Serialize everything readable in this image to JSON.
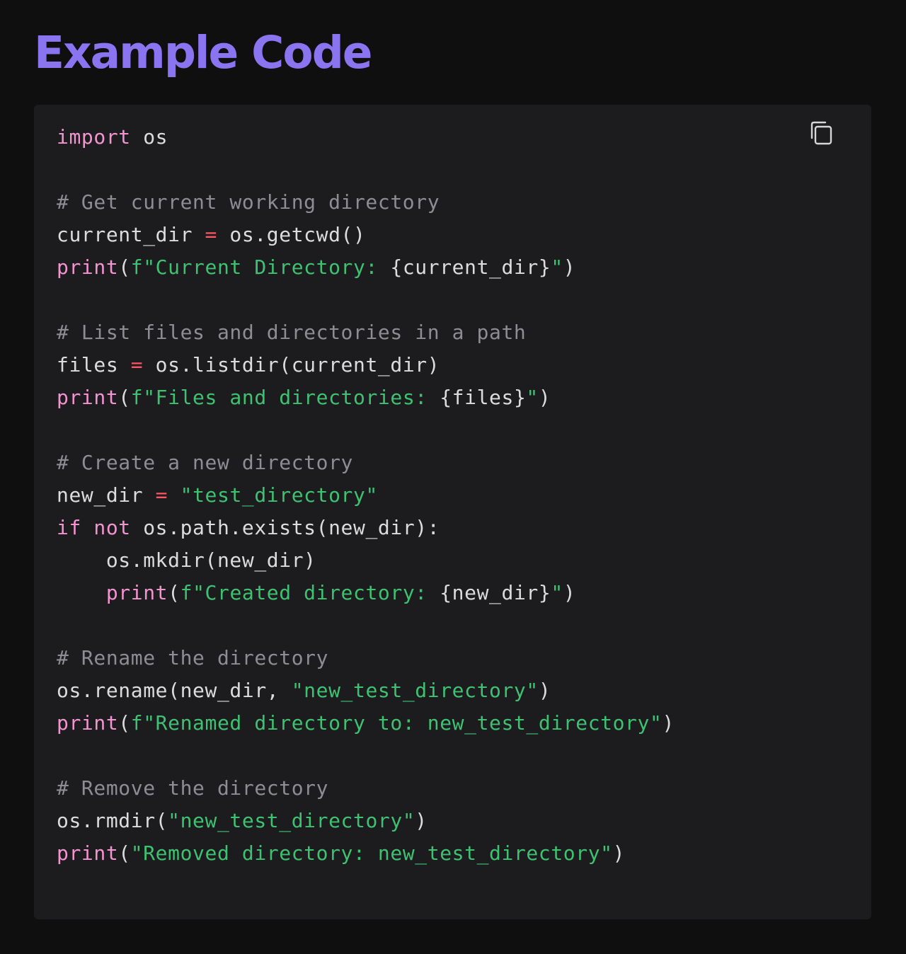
{
  "page": {
    "title": "Example Code"
  },
  "code_block": {
    "language": "python",
    "copy_icon": "copy-icon",
    "colors": {
      "background": "#1c1c1e",
      "title": "#8b74f0",
      "keyword": "#f294cf",
      "string": "#3ec272",
      "operator": "#ff5466",
      "comment": "#8e8e92",
      "plain": "#dcdcdc"
    },
    "lines": [
      [
        {
          "t": "keyword",
          "v": "import"
        },
        {
          "t": "plain",
          "v": " os"
        }
      ],
      [],
      [
        {
          "t": "comment",
          "v": "# Get current working directory"
        }
      ],
      [
        {
          "t": "plain",
          "v": "current_dir "
        },
        {
          "t": "operator",
          "v": "="
        },
        {
          "t": "plain",
          "v": " os.getcwd()"
        }
      ],
      [
        {
          "t": "keyword",
          "v": "print"
        },
        {
          "t": "plain",
          "v": "("
        },
        {
          "t": "string",
          "v": "f\"Current Directory: "
        },
        {
          "t": "plain",
          "v": "{current_dir}"
        },
        {
          "t": "string",
          "v": "\""
        },
        {
          "t": "plain",
          "v": ")"
        }
      ],
      [],
      [
        {
          "t": "comment",
          "v": "# List files and directories in a path"
        }
      ],
      [
        {
          "t": "plain",
          "v": "files "
        },
        {
          "t": "operator",
          "v": "="
        },
        {
          "t": "plain",
          "v": " os.listdir(current_dir)"
        }
      ],
      [
        {
          "t": "keyword",
          "v": "print"
        },
        {
          "t": "plain",
          "v": "("
        },
        {
          "t": "string",
          "v": "f\"Files and directories: "
        },
        {
          "t": "plain",
          "v": "{files}"
        },
        {
          "t": "string",
          "v": "\""
        },
        {
          "t": "plain",
          "v": ")"
        }
      ],
      [],
      [
        {
          "t": "comment",
          "v": "# Create a new directory"
        }
      ],
      [
        {
          "t": "plain",
          "v": "new_dir "
        },
        {
          "t": "operator",
          "v": "="
        },
        {
          "t": "plain",
          "v": " "
        },
        {
          "t": "string",
          "v": "\"test_directory\""
        }
      ],
      [
        {
          "t": "keyword",
          "v": "if"
        },
        {
          "t": "plain",
          "v": " "
        },
        {
          "t": "keyword",
          "v": "not"
        },
        {
          "t": "plain",
          "v": " os.path.exists(new_dir):"
        }
      ],
      [
        {
          "t": "plain",
          "v": "    os.mkdir(new_dir)"
        }
      ],
      [
        {
          "t": "plain",
          "v": "    "
        },
        {
          "t": "keyword",
          "v": "print"
        },
        {
          "t": "plain",
          "v": "("
        },
        {
          "t": "string",
          "v": "f\"Created directory: "
        },
        {
          "t": "plain",
          "v": "{new_dir}"
        },
        {
          "t": "string",
          "v": "\""
        },
        {
          "t": "plain",
          "v": ")"
        }
      ],
      [],
      [
        {
          "t": "comment",
          "v": "# Rename the directory"
        }
      ],
      [
        {
          "t": "plain",
          "v": "os.rename(new_dir, "
        },
        {
          "t": "string",
          "v": "\"new_test_directory\""
        },
        {
          "t": "plain",
          "v": ")"
        }
      ],
      [
        {
          "t": "keyword",
          "v": "print"
        },
        {
          "t": "plain",
          "v": "("
        },
        {
          "t": "string",
          "v": "f\"Renamed directory to: new_test_directory\""
        },
        {
          "t": "plain",
          "v": ")"
        }
      ],
      [],
      [
        {
          "t": "comment",
          "v": "# Remove the directory"
        }
      ],
      [
        {
          "t": "plain",
          "v": "os.rmdir("
        },
        {
          "t": "string",
          "v": "\"new_test_directory\""
        },
        {
          "t": "plain",
          "v": ")"
        }
      ],
      [
        {
          "t": "keyword",
          "v": "print"
        },
        {
          "t": "plain",
          "v": "("
        },
        {
          "t": "string",
          "v": "\"Removed directory: new_test_directory\""
        },
        {
          "t": "plain",
          "v": ")"
        }
      ]
    ]
  }
}
